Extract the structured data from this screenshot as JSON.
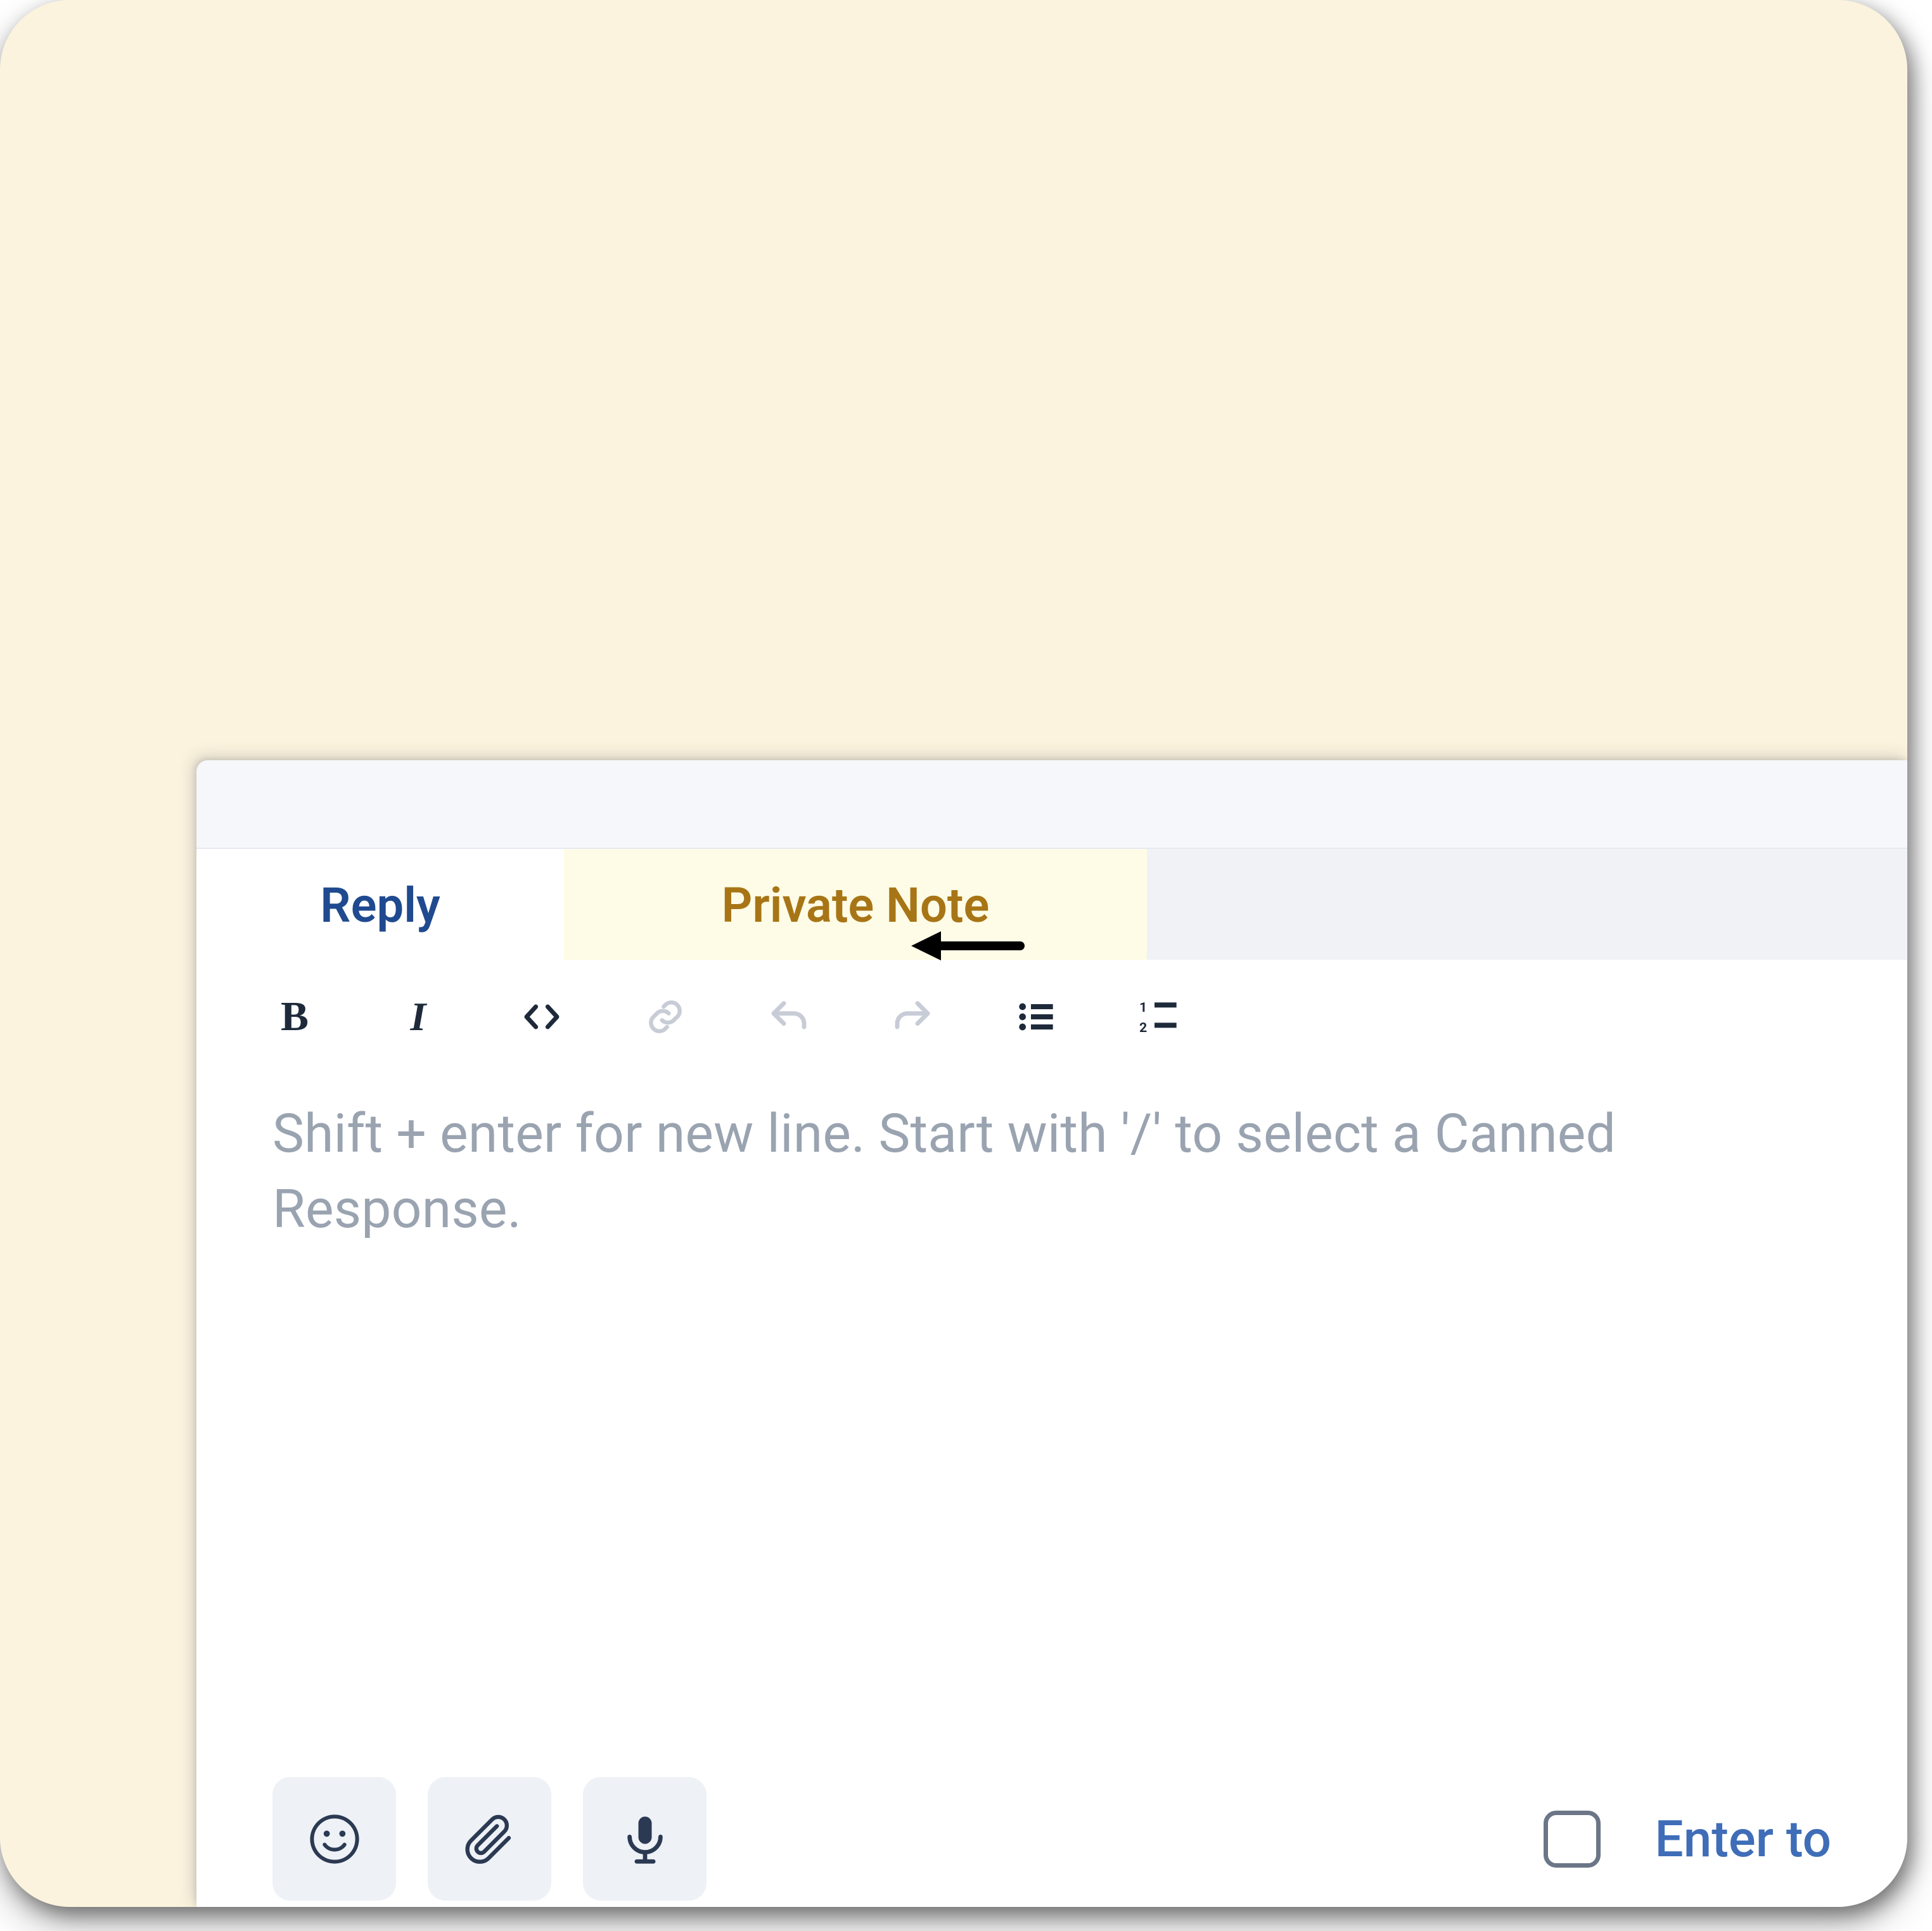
{
  "tabs": {
    "reply": "Reply",
    "private_note": "Private Note"
  },
  "toolbar": {
    "bold": "B",
    "italic": "I",
    "code": "code",
    "link": "link",
    "undo": "undo",
    "redo": "redo",
    "ul": "bulleted-list",
    "ol": "numbered-list"
  },
  "compose": {
    "placeholder": "Shift + enter for new line. Start with '/' to select a Canned Response."
  },
  "bottom": {
    "emoji": "emoji",
    "attach": "attachment",
    "audio": "microphone",
    "send_on_enter_label": "Enter to"
  }
}
